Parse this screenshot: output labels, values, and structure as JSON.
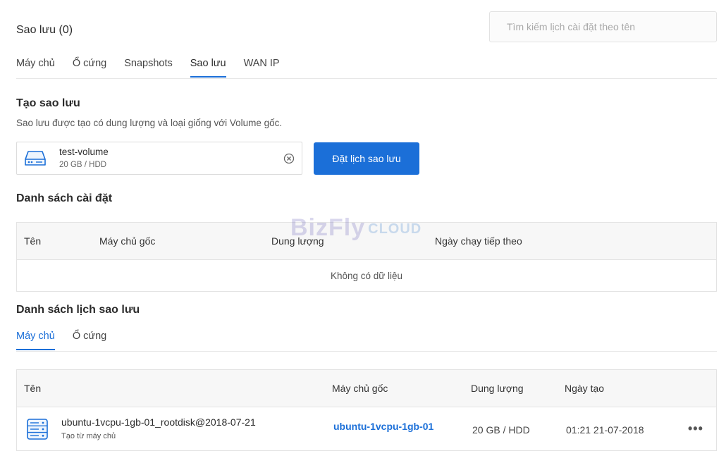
{
  "header": {
    "title": "Sao lưu (0)",
    "search_placeholder": "Tìm kiếm lịch cài đặt theo tên"
  },
  "tabs": [
    {
      "label": "Máy chủ",
      "active": false
    },
    {
      "label": "Ổ cứng",
      "active": false
    },
    {
      "label": "Snapshots",
      "active": false
    },
    {
      "label": "Sao lưu",
      "active": true
    },
    {
      "label": "WAN IP",
      "active": false
    }
  ],
  "create_backup": {
    "title": "Tạo sao lưu",
    "description": "Sao lưu được tạo có dung lượng và loại giống với Volume gốc.",
    "volume_name": "test-volume",
    "volume_info": "20 GB / HDD",
    "schedule_button": "Đặt lịch sao lưu"
  },
  "settings_list": {
    "title": "Danh sách cài đặt",
    "columns": [
      "Tên",
      "Máy chủ gốc",
      "Dung lượng",
      "Ngày chạy tiếp theo"
    ],
    "empty_text": "Không có dữ liệu"
  },
  "watermark": {
    "brand": "BizFly",
    "suffix": "CLOUD"
  },
  "schedule_list": {
    "title": "Danh sách lịch sao lưu",
    "tabs": [
      {
        "label": "Máy chủ",
        "active": true
      },
      {
        "label": "Ổ cứng",
        "active": false
      }
    ],
    "columns": [
      "Tên",
      "Máy chủ gốc",
      "Dung lượng",
      "Ngày tạo"
    ],
    "rows": [
      {
        "name": "ubuntu-1vcpu-1gb-01_rootdisk@2018-07-21",
        "subtitle": "Tạo từ máy chủ",
        "origin_server": "ubuntu-1vcpu-1gb-01",
        "size": "20 GB / HDD",
        "created": "01:21 21-07-2018",
        "more_icon": "more-horizontal-icon"
      }
    ]
  },
  "colors": {
    "accent": "#1b6fd8",
    "border": "#e3e3e3",
    "header_bg": "#f7f7f7"
  }
}
